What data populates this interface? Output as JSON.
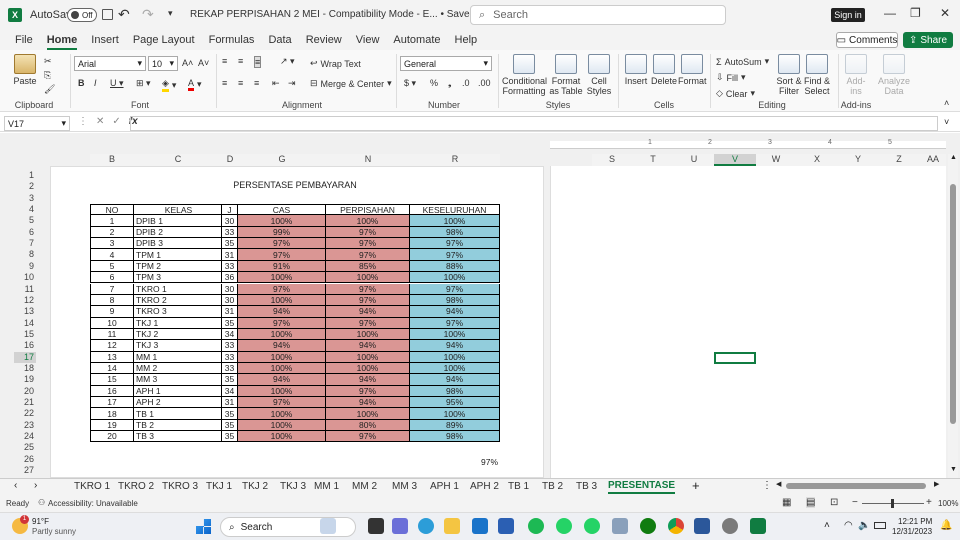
{
  "titlebar": {
    "autosave_label": "AutoSave",
    "autosave_state": "Off",
    "title": "REKAP PERPISAHAN 2 MEI  -  Compatibility Mode  -  E...  •  Saved to this PC",
    "search_placeholder": "Search",
    "signin": "Sign in"
  },
  "menu": [
    "File",
    "Home",
    "Insert",
    "Page Layout",
    "Formulas",
    "Data",
    "Review",
    "View",
    "Automate",
    "Help"
  ],
  "menu_active": "Home",
  "comments_label": "Comments",
  "share_label": "Share",
  "ribbon": {
    "clipboard": {
      "label": "Clipboard",
      "paste": "Paste"
    },
    "font": {
      "label": "Font",
      "name": "Arial",
      "size": "10"
    },
    "alignment": {
      "label": "Alignment",
      "wrap": "Wrap Text",
      "merge": "Merge & Center"
    },
    "number": {
      "label": "Number",
      "format": "General"
    },
    "styles": {
      "label": "Styles",
      "conditional": "Conditional Formatting",
      "format_table": "Format as Table",
      "cell_styles": "Cell Styles"
    },
    "cells": {
      "label": "Cells",
      "insert": "Insert",
      "delete": "Delete",
      "format": "Format"
    },
    "editing": {
      "label": "Editing",
      "autosum": "AutoSum",
      "fill": "Fill",
      "clear": "Clear",
      "sort": "Sort & Filter",
      "find": "Find & Select"
    },
    "addins": {
      "label": "Add-ins",
      "addins": "Add-ins",
      "analyze": "Analyze Data"
    }
  },
  "namebox": "V17",
  "fx": "fx",
  "columns_left": [
    "B",
    "C",
    "D",
    "G",
    "N",
    "R"
  ],
  "columns_right": [
    "S",
    "T",
    "U",
    "V",
    "W",
    "X",
    "Y",
    "Z",
    "AA"
  ],
  "ruler_marks": [
    "1",
    "2",
    "3",
    "4",
    "5"
  ],
  "rows": [
    "1",
    "2",
    "3",
    "4",
    "5",
    "6",
    "7",
    "8",
    "9",
    "10",
    "11",
    "12",
    "13",
    "14",
    "15",
    "16",
    "17",
    "18",
    "19",
    "20",
    "21",
    "22",
    "23",
    "24",
    "25",
    "26",
    "27"
  ],
  "sheet_title": "PERSENTASE PEMBAYARAN",
  "table": {
    "headers": [
      "NO",
      "KELAS",
      "J",
      "CAS",
      "PERPISAHAN",
      "KESELURUHAN"
    ],
    "rows": [
      [
        "1",
        "DPIB 1",
        "30",
        "100%",
        "100%",
        "100%"
      ],
      [
        "2",
        "DPIB 2",
        "33",
        "99%",
        "97%",
        "98%"
      ],
      [
        "3",
        "DPIB 3",
        "35",
        "97%",
        "97%",
        "97%"
      ],
      [
        "4",
        "TPM 1",
        "31",
        "97%",
        "97%",
        "97%"
      ],
      [
        "5",
        "TPM 2",
        "33",
        "91%",
        "85%",
        "88%"
      ],
      [
        "6",
        "TPM 3",
        "36",
        "100%",
        "100%",
        "100%"
      ],
      [
        "7",
        "TKRO 1",
        "30",
        "97%",
        "97%",
        "97%"
      ],
      [
        "8",
        "TKRO 2",
        "30",
        "100%",
        "97%",
        "98%"
      ],
      [
        "9",
        "TKRO 3",
        "31",
        "94%",
        "94%",
        "94%"
      ],
      [
        "10",
        "TKJ 1",
        "35",
        "97%",
        "97%",
        "97%"
      ],
      [
        "11",
        "TKJ 2",
        "34",
        "100%",
        "100%",
        "100%"
      ],
      [
        "12",
        "TKJ 3",
        "33",
        "94%",
        "94%",
        "94%"
      ],
      [
        "13",
        "MM 1",
        "33",
        "100%",
        "100%",
        "100%"
      ],
      [
        "14",
        "MM 2",
        "33",
        "100%",
        "100%",
        "100%"
      ],
      [
        "15",
        "MM 3",
        "35",
        "94%",
        "94%",
        "94%"
      ],
      [
        "16",
        "APH 1",
        "34",
        "100%",
        "97%",
        "98%"
      ],
      [
        "17",
        "APH 2",
        "31",
        "97%",
        "94%",
        "95%"
      ],
      [
        "18",
        "TB 1",
        "35",
        "100%",
        "100%",
        "100%"
      ],
      [
        "19",
        "TB 2",
        "35",
        "100%",
        "80%",
        "89%"
      ],
      [
        "20",
        "TB 3",
        "35",
        "100%",
        "97%",
        "98%"
      ]
    ],
    "total": "97%"
  },
  "sheets": [
    "TKRO 1",
    "TKRO 2",
    "TKRO 3",
    "TKJ 1",
    "TKJ 2",
    "TKJ 3",
    "MM 1",
    "MM 2",
    "MM 3",
    "APH 1",
    "APH 2",
    "TB 1",
    "TB 2",
    "TB 3",
    "PRESENTASE"
  ],
  "active_sheet": "PRESENTASE",
  "status": {
    "ready": "Ready",
    "accessibility": "Accessibility: Unavailable",
    "zoom": "100%"
  },
  "taskbar": {
    "temp": "91°F",
    "weather": "Partly sunny",
    "search": "Search",
    "time": "12:21 PM",
    "date": "12/31/2023",
    "badge": "1"
  },
  "colors": {
    "accent": "#107c41",
    "pink": "#da9694",
    "blue": "#92cddc"
  }
}
